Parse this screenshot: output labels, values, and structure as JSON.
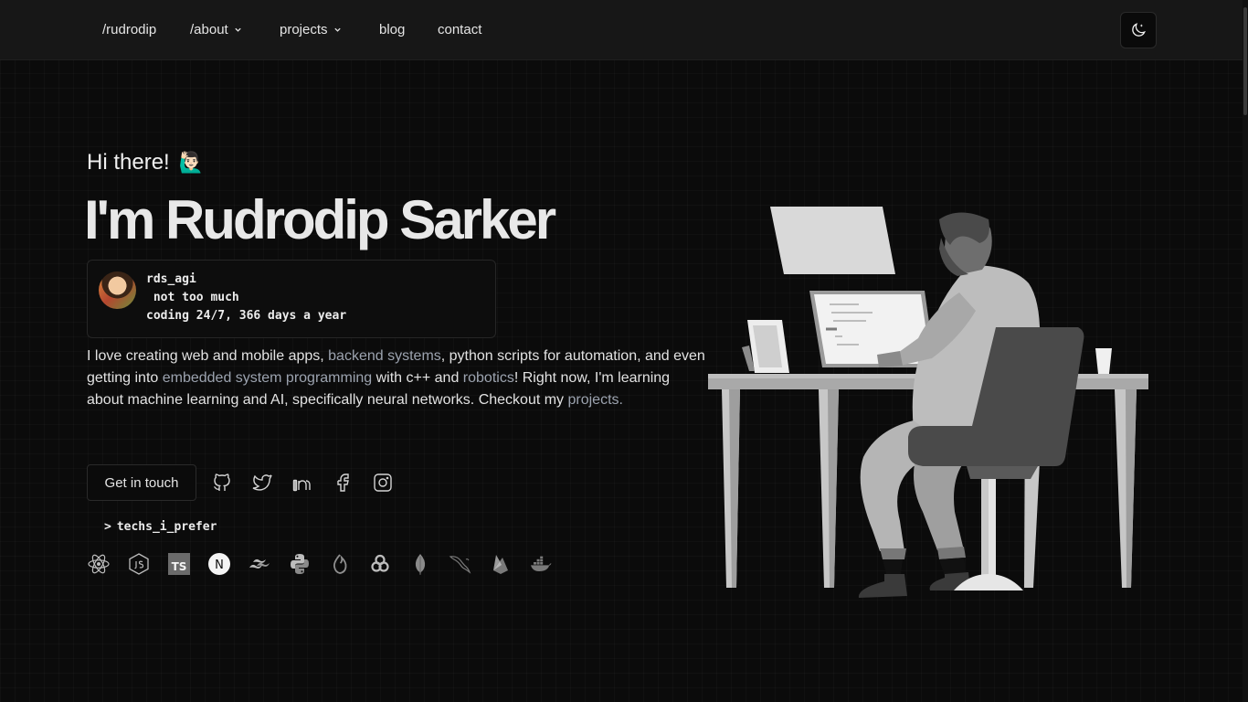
{
  "nav": {
    "brand": "/rudrodip",
    "about": "/about",
    "projects": "projects",
    "blog": "blog",
    "contact": "contact"
  },
  "hero": {
    "greeting": "Hi there!",
    "wave_emoji": "🙋🏻‍♂️",
    "name": "I'm Rudrodip Sarker"
  },
  "profile_card": {
    "handle": "rds_agi",
    "line2": " not too much",
    "line3": "coding 24/7, 366 days a year"
  },
  "bio": {
    "p1": "I love creating web and mobile apps, ",
    "link1": "backend systems",
    "p2": ", python scripts for automation, and even getting into ",
    "link2": "embedded system programming",
    "p3": " with c++ and ",
    "link3": "robotics",
    "p4": "! Right now, I'm learning about machine learning and AI, specifically neural networks. Checkout my ",
    "link4": "projects."
  },
  "cta": {
    "label": "Get in touch"
  },
  "socials": [
    "github-icon",
    "twitter-icon",
    "linkedin-icon",
    "facebook-icon",
    "instagram-icon"
  ],
  "techs": {
    "label": "techs_i_prefer",
    "prompt": ">",
    "icons": [
      "react-icon",
      "nodejs-icon",
      "typescript-icon",
      "nextjs-icon",
      "tailwind-icon",
      "python-icon",
      "prisma-icon",
      "graphql-icon",
      "mongodb-icon",
      "mysql-icon",
      "firebase-icon",
      "docker-icon"
    ],
    "ts_text": "TS",
    "next_text": "N"
  },
  "colors": {
    "background": "#0b0b0b",
    "navbar": "#171717",
    "text": "#e5e5e5",
    "link": "#9ca3af"
  }
}
